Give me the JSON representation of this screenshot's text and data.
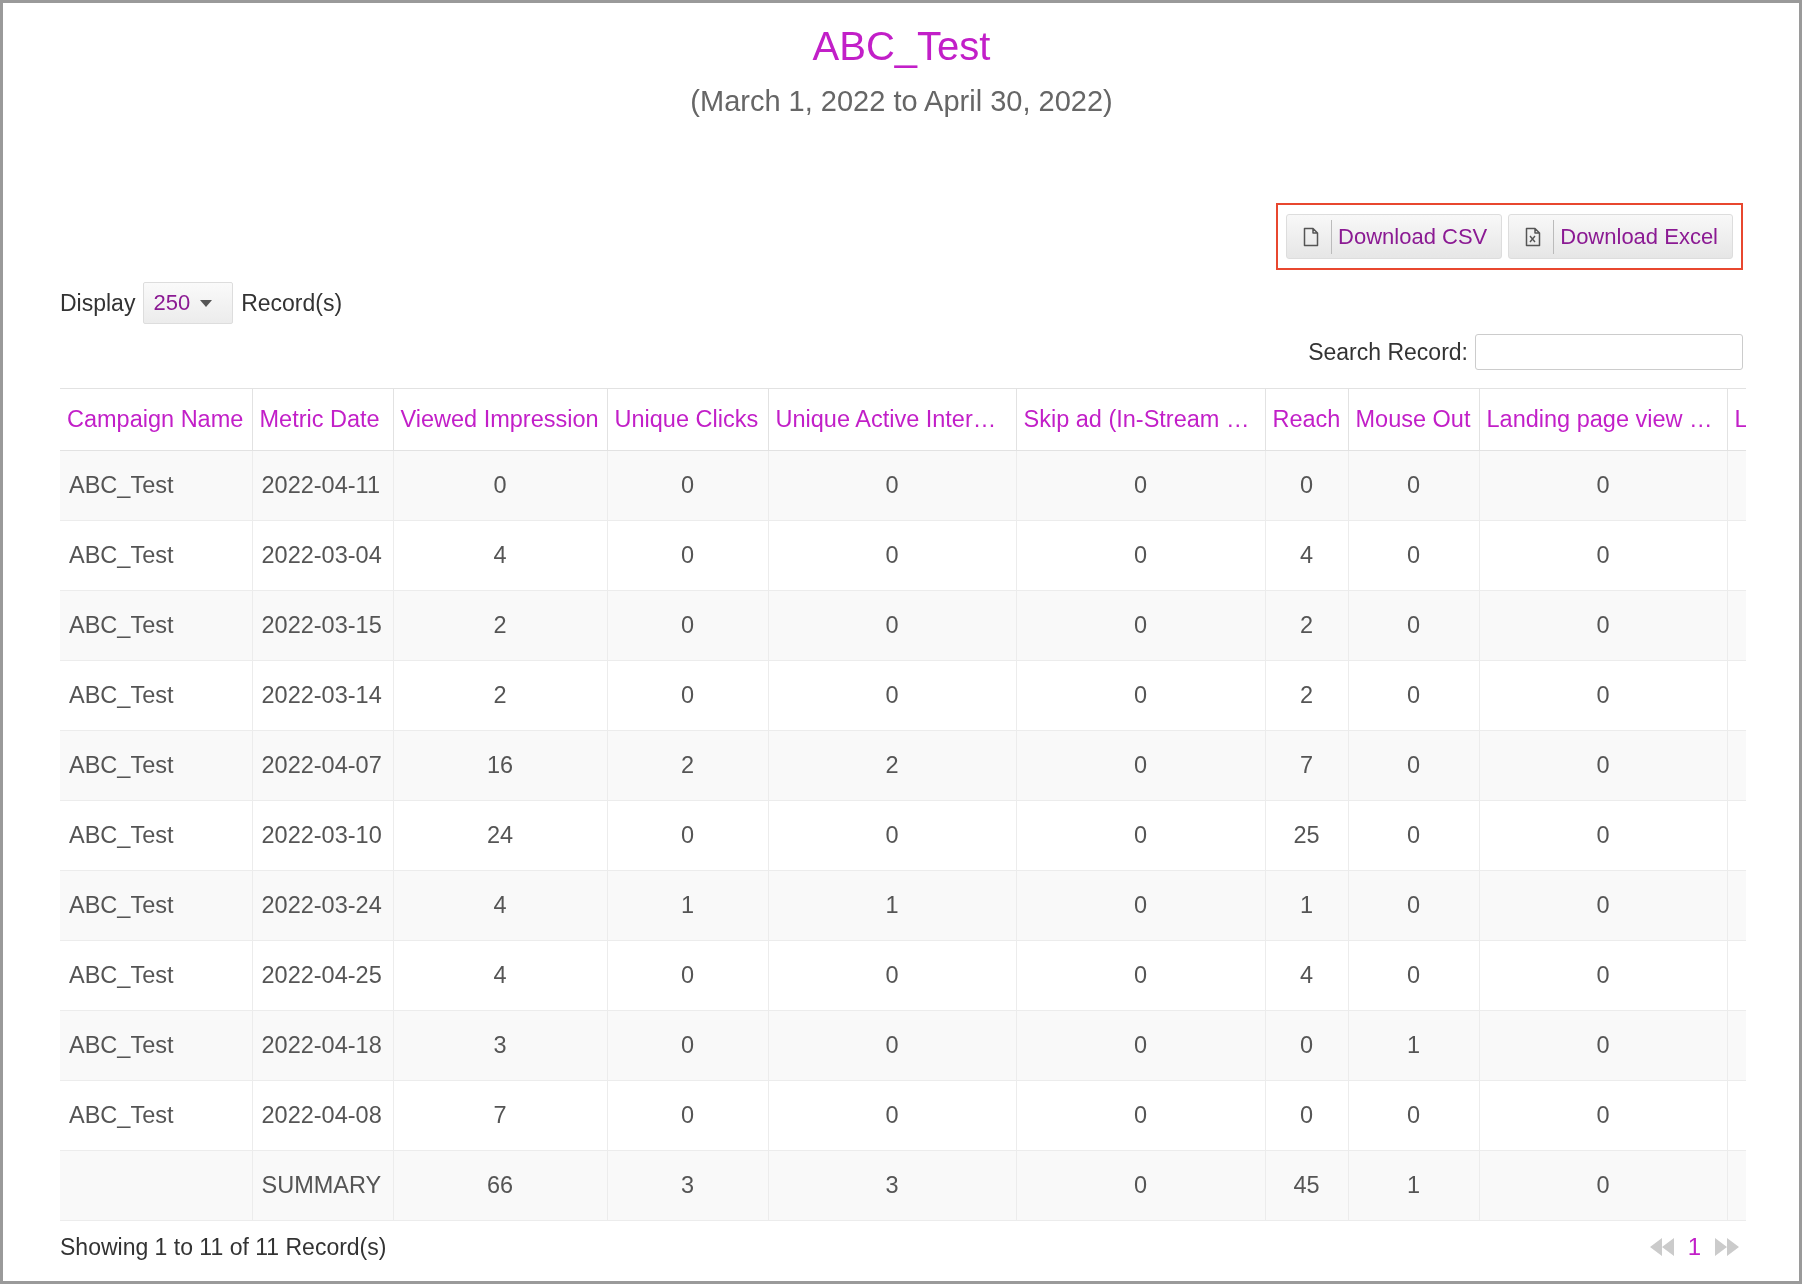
{
  "title": "ABC_Test",
  "subtitle": "(March 1, 2022 to April 30, 2022)",
  "downloads": {
    "highlighted": true,
    "buttons": [
      {
        "label": "Download CSV",
        "kind": "csv"
      },
      {
        "label": "Download Excel",
        "kind": "excel"
      }
    ]
  },
  "display": {
    "label": "Display",
    "value": "250",
    "suffix": "Record(s)"
  },
  "search": {
    "label": "Search Record:"
  },
  "table": {
    "columns": [
      "Campaign Name",
      "Metric Date",
      "Viewed Impression",
      "Unique Clicks",
      "Unique Active Inter…",
      "Skip ad (In-Stream …",
      "Reach",
      "Mouse Out",
      "Landing page view …",
      "L"
    ],
    "rows": [
      [
        "ABC_Test",
        "2022-04-11",
        "0",
        "0",
        "0",
        "0",
        "0",
        "0",
        "0"
      ],
      [
        "ABC_Test",
        "2022-03-04",
        "4",
        "0",
        "0",
        "0",
        "4",
        "0",
        "0"
      ],
      [
        "ABC_Test",
        "2022-03-15",
        "2",
        "0",
        "0",
        "0",
        "2",
        "0",
        "0"
      ],
      [
        "ABC_Test",
        "2022-03-14",
        "2",
        "0",
        "0",
        "0",
        "2",
        "0",
        "0"
      ],
      [
        "ABC_Test",
        "2022-04-07",
        "16",
        "2",
        "2",
        "0",
        "7",
        "0",
        "0"
      ],
      [
        "ABC_Test",
        "2022-03-10",
        "24",
        "0",
        "0",
        "0",
        "25",
        "0",
        "0"
      ],
      [
        "ABC_Test",
        "2022-03-24",
        "4",
        "1",
        "1",
        "0",
        "1",
        "0",
        "0"
      ],
      [
        "ABC_Test",
        "2022-04-25",
        "4",
        "0",
        "0",
        "0",
        "4",
        "0",
        "0"
      ],
      [
        "ABC_Test",
        "2022-04-18",
        "3",
        "0",
        "0",
        "0",
        "0",
        "1",
        "0"
      ],
      [
        "ABC_Test",
        "2022-04-08",
        "7",
        "0",
        "0",
        "0",
        "0",
        "0",
        "0"
      ]
    ],
    "summary": {
      "label": "SUMMARY",
      "values": [
        "66",
        "3",
        "3",
        "0",
        "45",
        "1",
        "0"
      ]
    }
  },
  "footer": {
    "info": "Showing 1 to 11 of 11 Record(s)"
  },
  "pagination": {
    "prev_disabled": true,
    "next_disabled": true,
    "pages": [
      {
        "label": "1",
        "selected": true
      }
    ]
  }
}
